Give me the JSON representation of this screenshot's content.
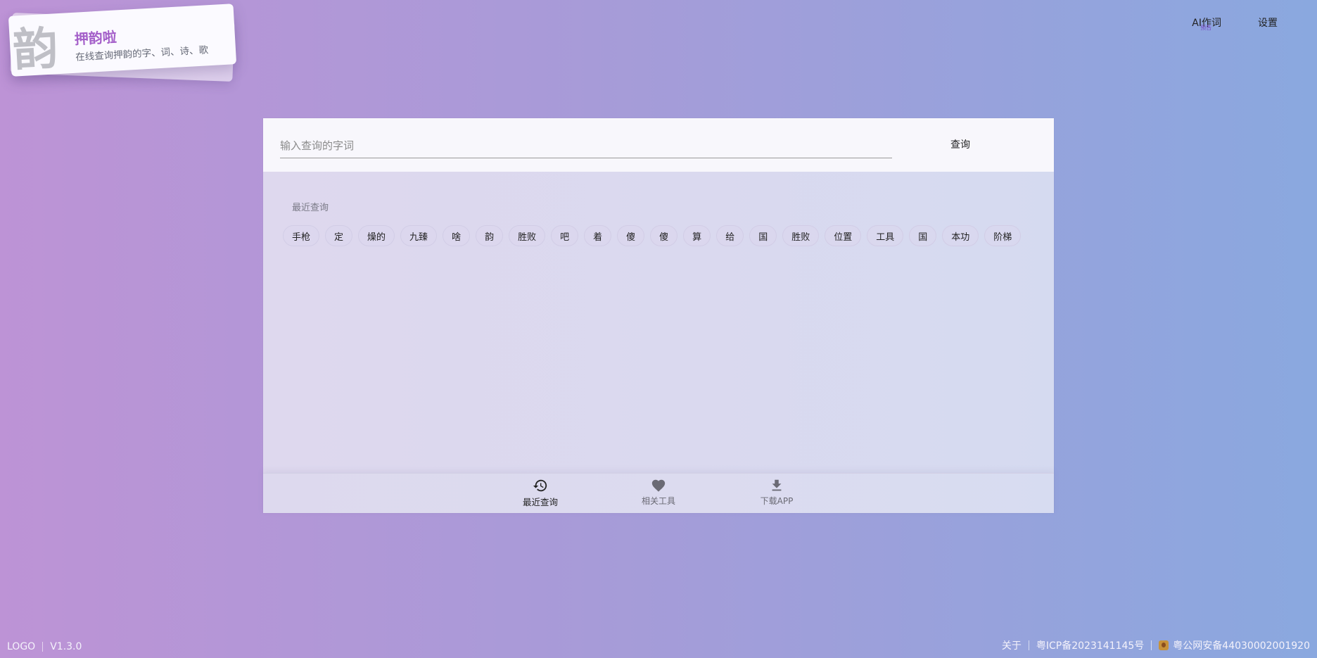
{
  "logo": {
    "glyph": "韵",
    "title": "押韵啦",
    "subtitle": "在线查询押韵的字、词、诗、歌"
  },
  "topnav": {
    "ai_label": "AI作词",
    "ai_badge": "预告",
    "settings_label": "设置"
  },
  "search": {
    "placeholder": "输入查询的字词",
    "value": "",
    "button_label": "查询"
  },
  "recent": {
    "title": "最近查询",
    "items": [
      "手枪",
      "定",
      "燥的",
      "九臻",
      "啥",
      "韵",
      "胜败",
      "吧",
      "着",
      "傻",
      "傻",
      "算",
      "给",
      "国",
      "胜败",
      "位置",
      "工具",
      "国",
      "本功",
      "阶梯"
    ]
  },
  "tabs": [
    {
      "label": "最近查询",
      "icon": "history-icon",
      "active": true
    },
    {
      "label": "相关工具",
      "icon": "heart-icon",
      "active": false
    },
    {
      "label": "下载APP",
      "icon": "download-icon",
      "active": false
    }
  ],
  "footer": {
    "logo_label": "LOGO",
    "version": "V1.3.0",
    "about": "关于",
    "icp": "粤ICP备2023141145号",
    "police": "粤公网安备44030002001920"
  },
  "colors": {
    "brand": "#a45fc9",
    "bg_start": "#bd93d6",
    "bg_end": "#8aa8df"
  }
}
